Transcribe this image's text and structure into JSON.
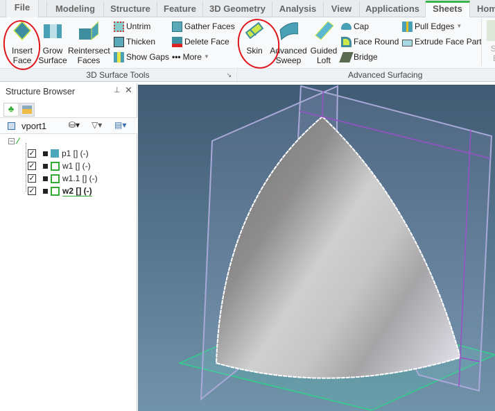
{
  "tabs": [
    {
      "label": "File"
    },
    {
      "label": "Modeling"
    },
    {
      "label": "Structure"
    },
    {
      "label": "Feature"
    },
    {
      "label": "3D Geometry"
    },
    {
      "label": "Analysis"
    },
    {
      "label": "View"
    },
    {
      "label": "Applications"
    },
    {
      "label": "Sheets",
      "active": true
    },
    {
      "label": "Hom"
    }
  ],
  "ribbon": {
    "group1": {
      "label": "3D Surface Tools",
      "insert_face": [
        "Insert",
        "Face"
      ],
      "grow_surface": [
        "Grow",
        "Surface"
      ],
      "reintersect": [
        "Reintersect",
        "Faces"
      ],
      "untrim": "Untrim",
      "thicken": "Thicken",
      "show_gaps": "Show Gaps",
      "gather_faces": "Gather Faces",
      "delete_face": "Delete Face",
      "more": "More"
    },
    "group2": {
      "label": "Advanced Surfacing",
      "skin": "Skin",
      "advanced_sweep": [
        "Advanced",
        "Sweep"
      ],
      "guided_loft": [
        "Guided",
        "Loft"
      ],
      "cap": "Cap",
      "face_round": "Face Round",
      "bridge": "Bridge",
      "pull_edges": "Pull Edges",
      "extrude_face_part": "Extrude Face Part",
      "su": [
        "Su",
        "E"
      ]
    }
  },
  "browser": {
    "title": "Structure Browser",
    "viewport_name": "vport1",
    "items": [
      {
        "label": "p1 []  (-)"
      },
      {
        "label": "w1 []  (-)"
      },
      {
        "label": "w1.1 []  (-)"
      },
      {
        "label": "w2 []  (-)"
      }
    ]
  },
  "colors": {
    "accent": "#3cb44a",
    "annotation": "#e0141a",
    "viewport_top": "#3f5b73",
    "viewport_bottom": "#7193aa"
  }
}
